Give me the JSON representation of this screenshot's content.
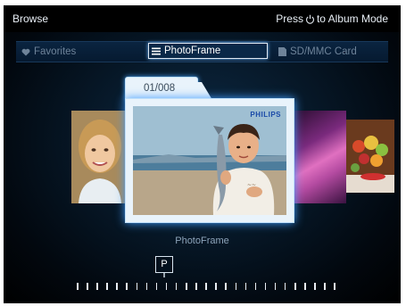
{
  "header": {
    "title": "Browse",
    "hint_prefix": "Press",
    "hint_suffix": "to Album Mode",
    "hint_icon": "power-icon"
  },
  "tabs": [
    {
      "label": "Favorites",
      "icon": "heart-icon",
      "active": false
    },
    {
      "label": "PhotoFrame",
      "icon": "list-icon",
      "active": true
    },
    {
      "label": "SD/MMC Card",
      "icon": "card-icon",
      "active": false
    }
  ],
  "viewer": {
    "counter": "01/008",
    "brand": "PHILIPS",
    "caption": "PhotoFrame"
  },
  "slider": {
    "marker": "P",
    "tick_count": 27
  },
  "colors": {
    "background": "#000000",
    "accent_glow": "#3f9cff",
    "frame": "#e9f3fb",
    "text": "#e8eef5",
    "muted_text": "#6e8399"
  }
}
